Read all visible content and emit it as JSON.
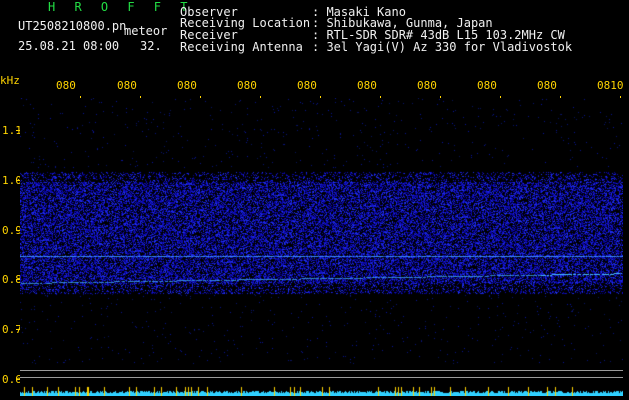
{
  "header": {
    "station": "H R O F F T",
    "filename": "UT2508210800.pn",
    "tag": "meteor",
    "date_time": "25.08.21 08:00",
    "count": "32.",
    "fields": [
      {
        "label": "Observer",
        "value": ": Masaki Kano"
      },
      {
        "label": "Receiving Location",
        "value": ": Shibukawa, Gunma, Japan"
      },
      {
        "label": "Receiver",
        "value": ": RTL-SDR SDR# 43dB L15 103.2MHz CW"
      },
      {
        "label": "Receiving Antenna",
        "value": ": 3el Yagi(V) Az 330 for Vladivostok"
      }
    ]
  },
  "axis": {
    "unit": "kHz",
    "y_labels": [
      "1.1",
      "1.0",
      "0.9",
      "0.8",
      "0.7",
      "0.6"
    ],
    "x_labels": [
      "080",
      "080",
      "080",
      "080",
      "080",
      "080",
      "080",
      "080",
      "080",
      "0810"
    ]
  },
  "colors": {
    "background": "#000000",
    "noise": "#2a3cff",
    "signal": "#3aa8ff",
    "label_yellow": "#ffd400",
    "station_green": "#22dd44"
  }
}
